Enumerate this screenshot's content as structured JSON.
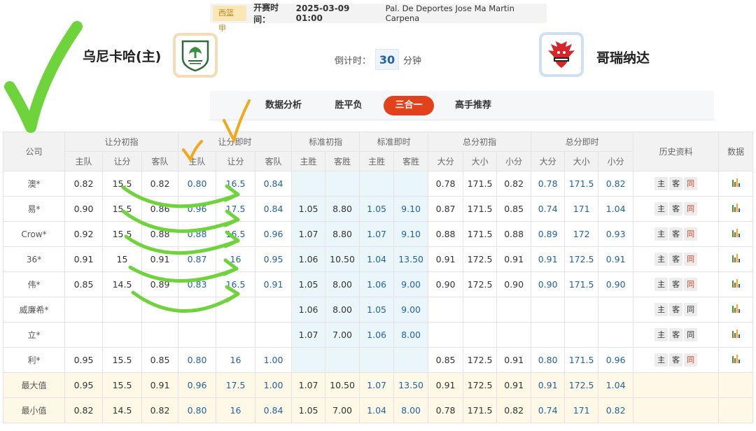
{
  "header": {
    "league": "西篮甲",
    "time_label": "开赛时间：",
    "time_value": "2025-03-09 01:00",
    "venue": "Pal. De Deportes Jose Ma Martin Carpena",
    "home_team": "乌尼卡哈(主)",
    "away_team": "哥瑞纳达",
    "countdown_label": "倒计时：",
    "countdown_value": "30",
    "countdown_unit": "分钟"
  },
  "tabs": [
    "数据分析",
    "胜平负",
    "三合一",
    "高手推荐"
  ],
  "active_tab": "三合一",
  "table": {
    "groups": [
      "公司",
      "让分初指",
      "让分即时",
      "标准初指",
      "标准即时",
      "总分初指",
      "总分即时",
      "历史资料",
      "数据"
    ],
    "sub": {
      "hc_init": [
        "主队",
        "让分",
        "客队"
      ],
      "hc_live": [
        "主队",
        "让分",
        "客队"
      ],
      "std_init": [
        "主胜",
        "客胜"
      ],
      "std_live": [
        "主胜",
        "客胜"
      ],
      "tot_init": [
        "大分",
        "大小",
        "小分"
      ],
      "tot_live": [
        "大分",
        "大小",
        "小分"
      ]
    },
    "history_buttons": [
      "主",
      "客",
      "同"
    ],
    "rows": [
      {
        "company": "澳*",
        "v": [
          "0.82",
          "15.5",
          "0.82",
          "0.80",
          "16.5",
          "0.84",
          "",
          "",
          "",
          "",
          "0.78",
          "171.5",
          "0.82",
          "0.78",
          "171.5",
          "0.82"
        ],
        "same_red": true
      },
      {
        "company": "易*",
        "v": [
          "0.90",
          "15.5",
          "0.86",
          "0.96",
          "17.5",
          "0.84",
          "1.05",
          "8.80",
          "1.05",
          "9.10",
          "0.87",
          "171.5",
          "0.85",
          "0.74",
          "171",
          "1.04"
        ],
        "same_red": true
      },
      {
        "company": "Crow*",
        "v": [
          "0.92",
          "15.5",
          "0.88",
          "0.88",
          "16.5",
          "0.96",
          "1.07",
          "8.80",
          "1.07",
          "9.10",
          "0.88",
          "171.5",
          "0.88",
          "0.89",
          "172",
          "0.93"
        ],
        "same_red": true
      },
      {
        "company": "36*",
        "v": [
          "0.91",
          "15",
          "0.91",
          "0.87",
          "16",
          "0.95",
          "1.06",
          "10.50",
          "1.04",
          "13.50",
          "0.91",
          "172.5",
          "0.91",
          "0.91",
          "172.5",
          "0.91"
        ],
        "same_red": true
      },
      {
        "company": "伟*",
        "v": [
          "0.85",
          "14.5",
          "0.89",
          "0.83",
          "16.5",
          "0.91",
          "1.05",
          "8.00",
          "1.06",
          "9.00",
          "0.90",
          "172.5",
          "0.90",
          "0.90",
          "171.5",
          "0.90"
        ],
        "same_red": true
      },
      {
        "company": "威廉希*",
        "v": [
          "",
          "",
          "",
          "",
          "",
          "",
          "1.06",
          "8.00",
          "1.05",
          "9.00",
          "",
          "",
          "",
          "",
          "",
          ""
        ],
        "same_red": false
      },
      {
        "company": "立*",
        "v": [
          "",
          "",
          "",
          "",
          "",
          "",
          "1.07",
          "7.00",
          "1.06",
          "8.00",
          "",
          "",
          "",
          "",
          "",
          ""
        ],
        "same_red": false
      },
      {
        "company": "利*",
        "v": [
          "0.95",
          "15.5",
          "0.85",
          "0.80",
          "16",
          "1.00",
          "",
          "",
          "",
          "",
          "0.85",
          "172.5",
          "0.91",
          "0.80",
          "171.5",
          "0.96"
        ],
        "same_red": true
      }
    ],
    "summary": [
      {
        "label": "最大值",
        "v": [
          "0.95",
          "15.5",
          "0.91",
          "0.96",
          "17.5",
          "1.00",
          "1.07",
          "10.50",
          "1.07",
          "13.50",
          "0.91",
          "172.5",
          "0.91",
          "0.91",
          "172.5",
          "1.04"
        ]
      },
      {
        "label": "最小值",
        "v": [
          "0.82",
          "14.5",
          "0.82",
          "0.80",
          "16",
          "0.84",
          "1.05",
          "7.00",
          "1.04",
          "8.00",
          "0.78",
          "171.5",
          "0.82",
          "0.74",
          "171",
          "0.82"
        ]
      }
    ]
  },
  "colors": {
    "accent": "#e2421b",
    "blue_value": "#2262a8",
    "std_bg": "#eaf6fa",
    "summary_bg": "#fdf9e6",
    "green_mark": "#6fd33c",
    "orange_mark": "#f0a81c"
  },
  "icons": {
    "data_icon": "bar-chart-icon",
    "home_logo": "home-team-logo",
    "away_logo": "away-team-logo"
  }
}
